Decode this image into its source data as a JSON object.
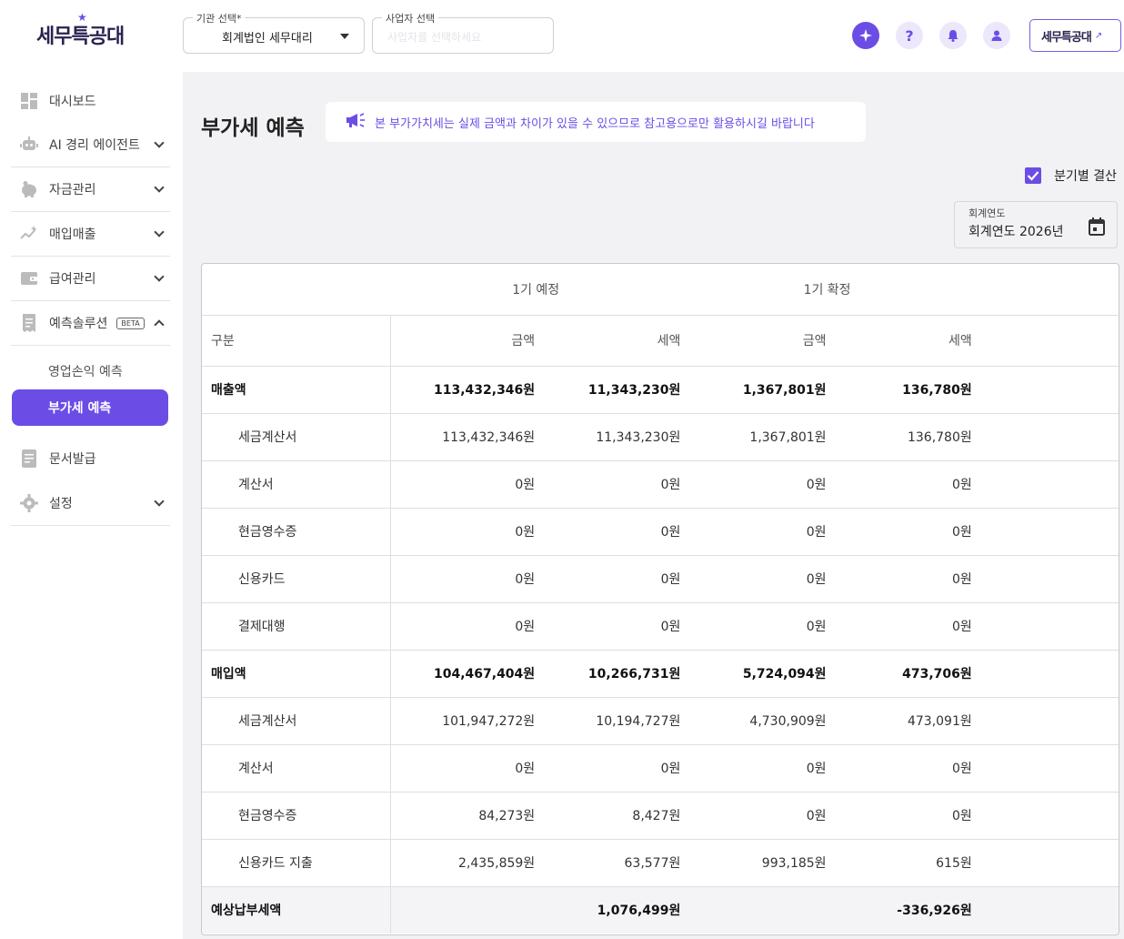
{
  "brand": {
    "logo_text": "세무특공대",
    "button_text": "세무특공대"
  },
  "header": {
    "org_select": {
      "label": "기관 선택*",
      "value": "회계법인 세무대리"
    },
    "business_select": {
      "label": "사업자 선택",
      "placeholder": "사업자를 선택하세요"
    }
  },
  "sidebar": {
    "items": [
      {
        "label": "대시보드"
      },
      {
        "label": "AI 경리 에이전트"
      },
      {
        "label": "자금관리"
      },
      {
        "label": "매입매출"
      },
      {
        "label": "급여관리"
      },
      {
        "label": "예측솔루션",
        "badge": "BETA"
      },
      {
        "label": "문서발급"
      },
      {
        "label": "설정"
      }
    ],
    "sub_items": [
      {
        "label": "영업손익 예측"
      },
      {
        "label": "부가세 예측"
      }
    ]
  },
  "main": {
    "title": "부가세 예측",
    "notice": "본 부가가치세는 실제 금액과 차이가 있을 수 있으므로 참고용으로만 활용하시길 바랍니다",
    "quarterly_checkbox_label": "분기별 결산",
    "fiscal_year": {
      "label": "회계연도",
      "value": "회계연도 2026년"
    }
  },
  "table": {
    "group_headers": [
      "1기 예정",
      "1기 확정"
    ],
    "columns": [
      "구분",
      "금액",
      "세액",
      "금액",
      "세액"
    ],
    "rows": [
      {
        "label": "매출액",
        "cells": [
          "113,432,346원",
          "11,343,230원",
          "1,367,801원",
          "136,780원"
        ]
      },
      {
        "label": "세금계산서",
        "cells": [
          "113,432,346원",
          "11,343,230원",
          "1,367,801원",
          "136,780원"
        ]
      },
      {
        "label": "계산서",
        "cells": [
          "0원",
          "0원",
          "0원",
          "0원"
        ]
      },
      {
        "label": "현금영수증",
        "cells": [
          "0원",
          "0원",
          "0원",
          "0원"
        ]
      },
      {
        "label": "신용카드",
        "cells": [
          "0원",
          "0원",
          "0원",
          "0원"
        ]
      },
      {
        "label": "결제대행",
        "cells": [
          "0원",
          "0원",
          "0원",
          "0원"
        ]
      },
      {
        "label": "매입액",
        "cells": [
          "104,467,404원",
          "10,266,731원",
          "5,724,094원",
          "473,706원"
        ]
      },
      {
        "label": "세금계산서",
        "cells": [
          "101,947,272원",
          "10,194,727원",
          "4,730,909원",
          "473,091원"
        ]
      },
      {
        "label": "계산서",
        "cells": [
          "0원",
          "0원",
          "0원",
          "0원"
        ]
      },
      {
        "label": "현금영수증",
        "cells": [
          "84,273원",
          "8,427원",
          "0원",
          "0원"
        ]
      },
      {
        "label": "신용카드 지출",
        "cells": [
          "2,435,859원",
          "63,577원",
          "993,185원",
          "615원"
        ]
      },
      {
        "label": "예상납부세액",
        "cells": [
          "",
          "1,076,499원",
          "",
          "-336,926원"
        ]
      }
    ]
  },
  "colors": {
    "accent": "#6b4de6",
    "accent_light": "#ece7fb",
    "main_bg": "#f2f2f4"
  },
  "icons": [
    "dashboard-icon",
    "robot-icon",
    "piggy-bank-icon",
    "sparkle-chart-icon",
    "wallet-icon",
    "receipt-icon",
    "document-icon",
    "gear-icon",
    "megaphone-icon",
    "calendar-icon",
    "ai-sparkle-icon",
    "help-icon",
    "bell-icon",
    "user-icon"
  ]
}
